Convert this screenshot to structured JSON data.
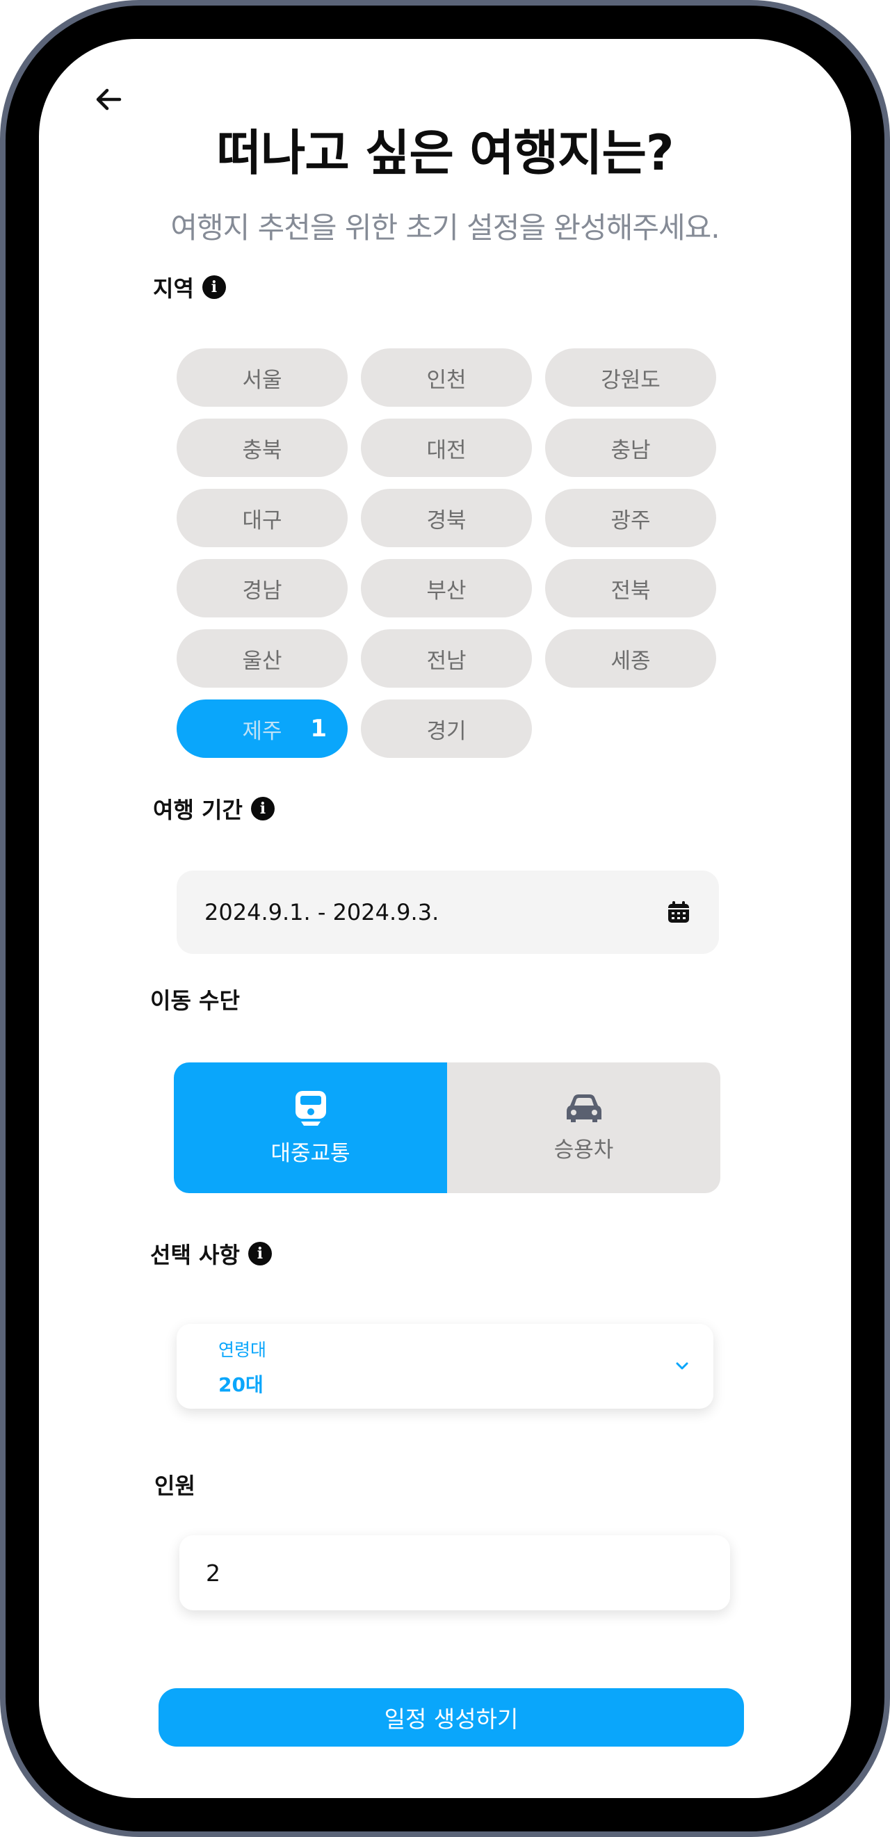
{
  "header": {
    "title": "떠나고 싶은 여행지는?",
    "subtitle": "여행지 추천을 위한 초기 설정을 완성해주세요."
  },
  "region": {
    "label": "지역",
    "chips": [
      "서울",
      "인천",
      "강원도",
      "충북",
      "대전",
      "충남",
      "대구",
      "경북",
      "광주",
      "경남",
      "부산",
      "전북",
      "울산",
      "전남",
      "세종",
      "제주",
      "경기"
    ],
    "selected": "제주",
    "selected_count": "1"
  },
  "period": {
    "label": "여행 기간",
    "value": "2024.9.1.  -  2024.9.3."
  },
  "transport": {
    "label": "이동 수단",
    "options": [
      {
        "label": "대중교통",
        "icon": "train-icon",
        "selected": true
      },
      {
        "label": "승용차",
        "icon": "car-icon",
        "selected": false
      }
    ]
  },
  "options": {
    "label": "선택 사항",
    "age_label": "연령대",
    "age_value": "20대"
  },
  "people": {
    "label": "인원",
    "value": "2"
  },
  "submit_label": "일정 생성하기",
  "colors": {
    "accent": "#0aa6fb",
    "chip_bg": "#e6e4e3",
    "chip_text": "#6e6e6e",
    "subtitle": "#858b96"
  }
}
